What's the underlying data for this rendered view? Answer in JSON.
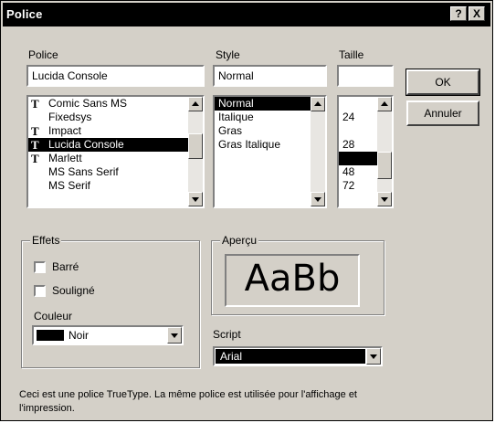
{
  "window": {
    "title": "Police",
    "help_label": "?",
    "close_label": "X"
  },
  "font": {
    "label": "Police",
    "value": "Lucida Console",
    "items": [
      {
        "name": "Comic Sans MS",
        "truetype": true,
        "selected": false
      },
      {
        "name": "Fixedsys",
        "truetype": false,
        "selected": false
      },
      {
        "name": "Impact",
        "truetype": true,
        "selected": false
      },
      {
        "name": "Lucida Console",
        "truetype": true,
        "selected": true
      },
      {
        "name": "Marlett",
        "truetype": true,
        "selected": false
      },
      {
        "name": "MS Sans Serif",
        "truetype": false,
        "selected": false
      },
      {
        "name": "MS Serif",
        "truetype": false,
        "selected": false
      }
    ]
  },
  "style": {
    "label": "Style",
    "value": "Normal",
    "items": [
      {
        "name": "Normal",
        "selected": true
      },
      {
        "name": "Italique",
        "selected": false
      },
      {
        "name": "Gras",
        "selected": false
      },
      {
        "name": "Gras Italique",
        "selected": false
      }
    ]
  },
  "size": {
    "label": "Taille",
    "value": "",
    "items": [
      {
        "name": "",
        "selected": false
      },
      {
        "name": "24",
        "selected": false
      },
      {
        "name": "",
        "selected": false
      },
      {
        "name": "28",
        "selected": false
      },
      {
        "name": "",
        "selected": true
      },
      {
        "name": "48",
        "selected": false
      },
      {
        "name": "72",
        "selected": false
      }
    ]
  },
  "buttons": {
    "ok": "OK",
    "cancel": "Annuler"
  },
  "effects": {
    "title": "Effets",
    "strikeout": "Barré",
    "underline": "Souligné",
    "color_label": "Couleur",
    "color_value": "Noir",
    "color_hex": "#000000"
  },
  "sample": {
    "title": "Aperçu",
    "text": "AaBb"
  },
  "script": {
    "label": "Script",
    "value": "Arial"
  },
  "description": "Ceci est une police TrueType. La même police est utilisée pour l'affichage et l'impression."
}
